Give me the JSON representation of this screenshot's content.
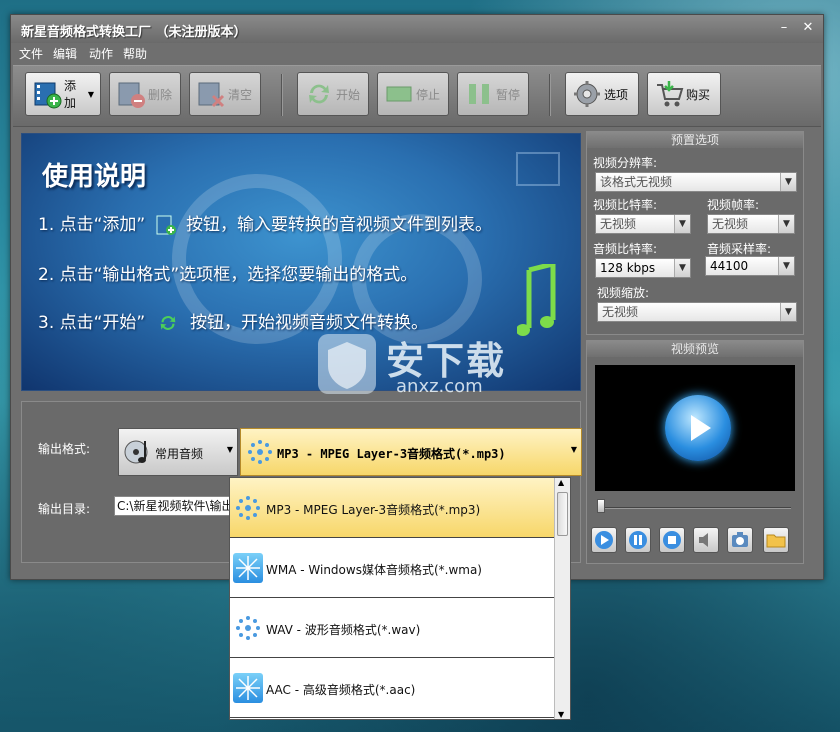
{
  "window": {
    "title": "新星音频格式转换工厂  （未注册版本）",
    "minimize": "–",
    "close": "✕"
  },
  "menu": [
    "文件",
    "编辑",
    "动作",
    "帮助"
  ],
  "toolbar": {
    "add": "添加",
    "delete": "删除",
    "clear": "清空",
    "start": "开始",
    "stop": "停止",
    "pause": "暂停",
    "options": "选项",
    "buy": "购买"
  },
  "banner": {
    "heading": "使用说明",
    "line1_a": "1. 点击“添加”",
    "line1_b": "按钮，输入要转换的音视频文件到列表。",
    "line2": "2. 点击“输出格式”选项框，选择您要输出的格式。",
    "line3_a": "3. 点击“开始”",
    "line3_b": "按钮，开始视频音频文件转换。"
  },
  "preset": {
    "title": "预置选项",
    "video_resolution_label": "视频分辨率:",
    "video_resolution_value": "该格式无视频",
    "video_bitrate_label": "视频比特率:",
    "video_bitrate_value": "无视频",
    "video_fps_label": "视频帧率:",
    "video_fps_value": "无视频",
    "audio_bitrate_label": "音频比特率:",
    "audio_bitrate_value": "128 kbps",
    "audio_samplerate_label": "音频采样率:",
    "audio_samplerate_value": "44100",
    "video_scale_label": "视频缩放:",
    "video_scale_value": "无视频"
  },
  "preview": {
    "title": "视频预览"
  },
  "output": {
    "format_label": "输出格式:",
    "category": "常用音频",
    "selected_format": "MP3 - MPEG Layer-3音频格式(*.mp3)",
    "dir_label": "输出目录:",
    "dir_value": "C:\\新星视频软件\\输出"
  },
  "dropdown": {
    "items": [
      "MP3 - MPEG Layer-3音频格式(*.mp3)",
      "WMA - Windows媒体音频格式(*.wma)",
      "WAV - 波形音频格式(*.wav)",
      "AAC - 高级音频格式(*.aac)"
    ]
  },
  "watermark": {
    "cn": "安下载",
    "en": "anxz.com"
  },
  "colors": {
    "accent": "#f7d76a",
    "window_bg": "#6f6f6f",
    "banner": "#2a6fb0"
  }
}
